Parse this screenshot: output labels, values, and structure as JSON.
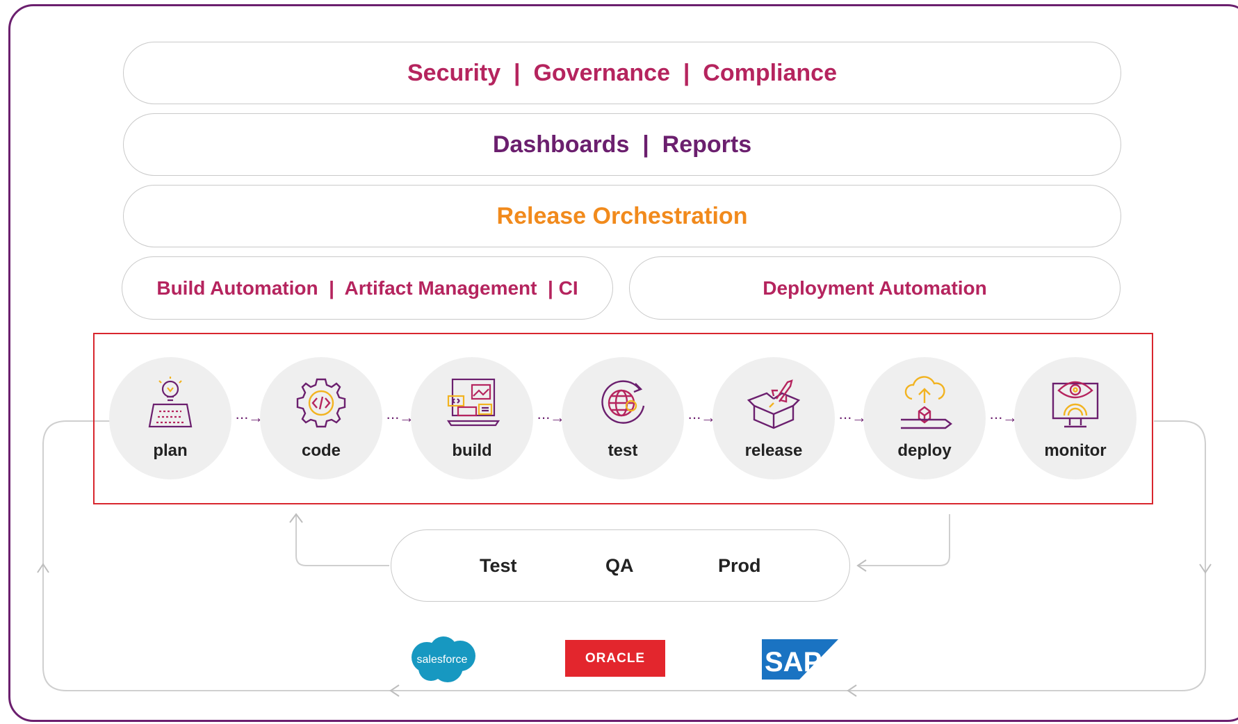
{
  "layers": {
    "governance": "Security  |  Governance  |  Compliance",
    "reporting": "Dashboards  |  Reports",
    "orchestration": "Release Orchestration",
    "build": "Build Automation  |  Artifact Management  | CI",
    "deployment": "Deployment Automation"
  },
  "pipeline": {
    "stages": [
      {
        "label": "plan",
        "icon": "plan-blueprint-lightbulb-icon"
      },
      {
        "label": "code",
        "icon": "code-gear-icon"
      },
      {
        "label": "build",
        "icon": "build-laptop-icon"
      },
      {
        "label": "test",
        "icon": "test-globe-cycle-icon"
      },
      {
        "label": "release",
        "icon": "release-box-rocket-icon"
      },
      {
        "label": "deploy",
        "icon": "deploy-cloud-upload-icon"
      },
      {
        "label": "monitor",
        "icon": "monitor-eye-icon"
      }
    ],
    "arrow": "···→"
  },
  "environments": [
    "Test",
    "QA",
    "Prod"
  ],
  "platforms": {
    "salesforce": "salesforce",
    "oracle": "ORACLE",
    "sap": "SAP"
  },
  "colors": {
    "frame": "#6b1f6e",
    "magenta": "#b5245e",
    "purple": "#6b1f6e",
    "orange": "#f18a1c",
    "pipeline_border": "#d8262e",
    "salesforce_blue": "#1798c1",
    "oracle_red": "#e3262d",
    "sap_blue": "#1a73c2"
  }
}
